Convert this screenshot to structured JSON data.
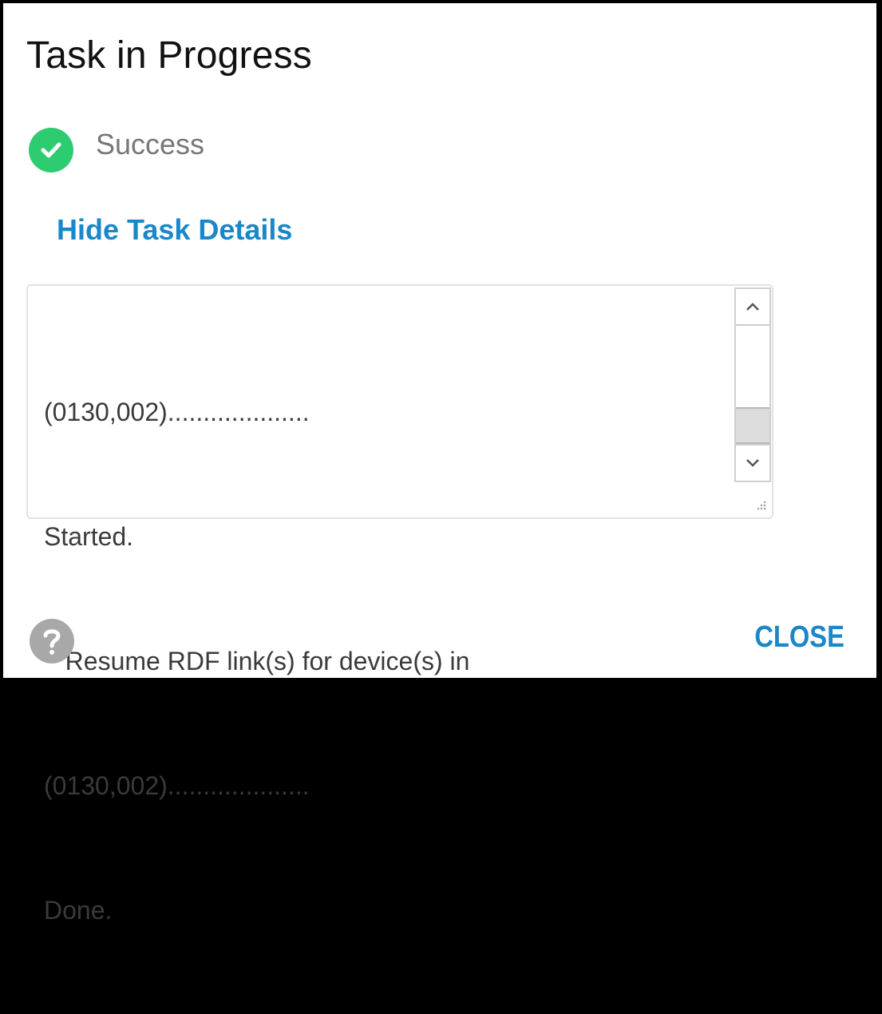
{
  "dialog": {
    "title": "Task in Progress",
    "status": {
      "icon": "check-circle-icon",
      "text": "Success",
      "color": "#2ecc71"
    },
    "details_toggle_label": "Hide Task Details",
    "log": {
      "lines": [
        "(0130,002)....................",
        "Started.",
        "   Resume RDF link(s) for device(s) in",
        "(0130,002)....................",
        "Done."
      ],
      "scroll_position": 0.95
    },
    "footer": {
      "help_icon": "question-circle-icon",
      "close_label": "CLOSE"
    },
    "accent_color": "#1a87c9"
  }
}
